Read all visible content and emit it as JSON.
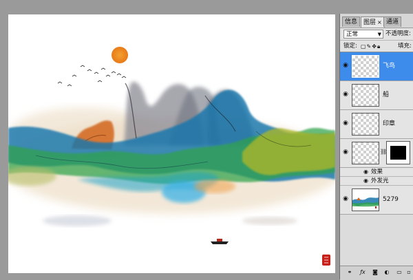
{
  "panel": {
    "tabs": [
      {
        "label": "信息"
      },
      {
        "label": "图层",
        "close": "×"
      },
      {
        "label": "通道"
      }
    ],
    "blend_mode": "正常",
    "opacity_label": "不透明度:",
    "lock_label": "锁定:",
    "fill_label": "填充:",
    "layers": [
      {
        "name": "飞鸟",
        "selected": true
      },
      {
        "name": "船"
      },
      {
        "name": "印章"
      },
      {
        "name": "",
        "has_mask": true
      },
      {
        "name": "5279"
      }
    ],
    "effects": {
      "label": "效果",
      "outer_glow": "外发光"
    },
    "bottom_icons": [
      "link-icon",
      "fx-icon",
      "mask-icon",
      "adjustment-icon",
      "group-icon",
      "new-layer-icon"
    ]
  },
  "colors": {
    "workspace": "#9a9a9a",
    "selection": "#3d8bea",
    "ink_blue": "#1a6fa8",
    "ink_green": "#3aa04a",
    "sun": "#f0902a",
    "seal": "#c8201a"
  }
}
